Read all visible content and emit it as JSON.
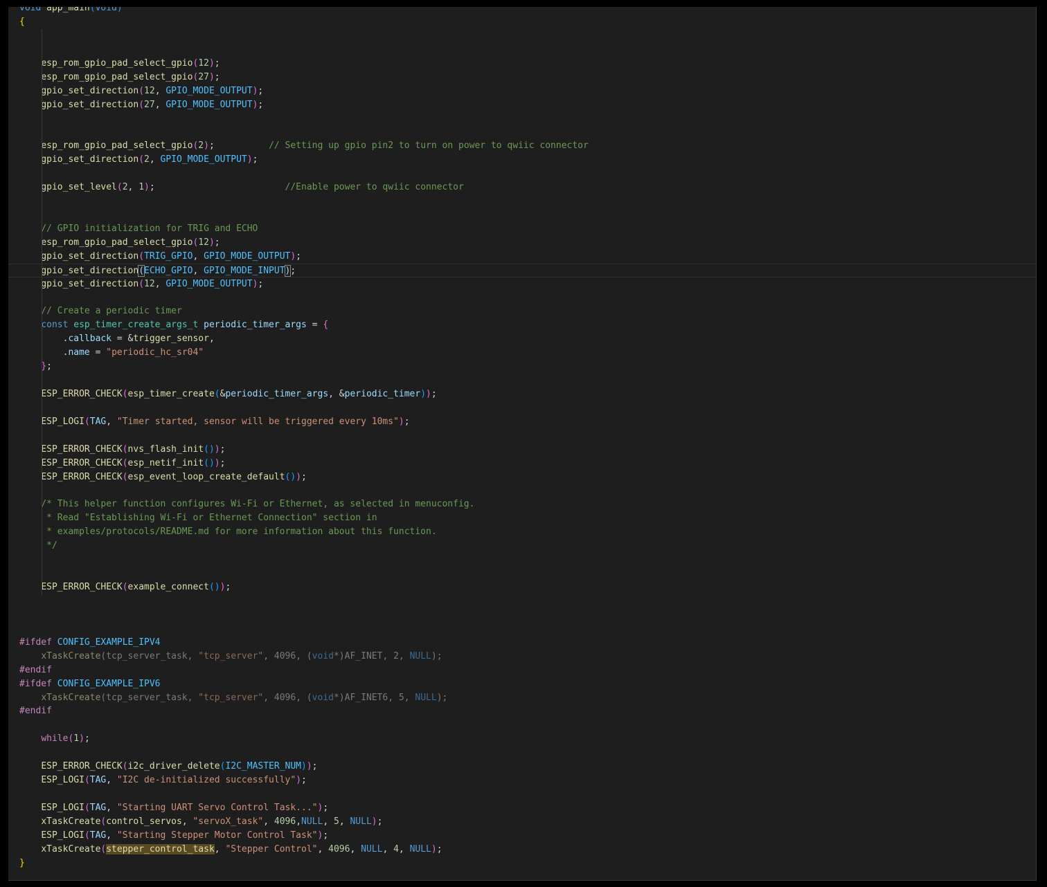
{
  "editor": {
    "language": "c",
    "theme": "dark",
    "colors": {
      "background": "#1e1e1e",
      "default": "#d4d4d4",
      "keyword": "#569cd6",
      "function": "#dcdcaa",
      "string": "#ce9178",
      "number": "#b5cea8",
      "comment": "#6a9955",
      "constant": "#4fc1ff",
      "macro": "#c586c0"
    },
    "current_line": 19,
    "lines": [
      [
        [
          "void",
          "kw"
        ],
        [
          " app_main",
          "fn"
        ],
        [
          "(",
          "bracket"
        ],
        [
          "void",
          "kw"
        ],
        [
          ")",
          "bracket"
        ]
      ],
      [
        [
          "{",
          "brace"
        ]
      ],
      [],
      [],
      [
        [
          "    "
        ],
        [
          "esp_rom_gpio_pad_select_gpio",
          "fn"
        ],
        [
          "(",
          "paren"
        ],
        [
          "12",
          "num"
        ],
        [
          ")",
          "paren"
        ],
        [
          ";"
        ]
      ],
      [
        [
          "    "
        ],
        [
          "esp_rom_gpio_pad_select_gpio",
          "fn"
        ],
        [
          "(",
          "paren"
        ],
        [
          "27",
          "num"
        ],
        [
          ")",
          "paren"
        ],
        [
          ";"
        ]
      ],
      [
        [
          "    "
        ],
        [
          "gpio_set_direction",
          "fn"
        ],
        [
          "(",
          "paren"
        ],
        [
          "12",
          "num"
        ],
        [
          ", "
        ],
        [
          "GPIO_MODE_OUTPUT",
          "const"
        ],
        [
          ")",
          "paren"
        ],
        [
          ";"
        ]
      ],
      [
        [
          "    "
        ],
        [
          "gpio_set_direction",
          "fn"
        ],
        [
          "(",
          "paren"
        ],
        [
          "27",
          "num"
        ],
        [
          ", "
        ],
        [
          "GPIO_MODE_OUTPUT",
          "const"
        ],
        [
          ")",
          "paren"
        ],
        [
          ";"
        ]
      ],
      [],
      [],
      [
        [
          "    "
        ],
        [
          "esp_rom_gpio_pad_select_gpio",
          "fn"
        ],
        [
          "(",
          "paren"
        ],
        [
          "2",
          "num"
        ],
        [
          ")",
          "paren"
        ],
        [
          ";"
        ],
        [
          "          "
        ],
        [
          "// Setting up gpio pin2 to turn on power to qwiic connector",
          "cmt"
        ]
      ],
      [
        [
          "    "
        ],
        [
          "gpio_set_direction",
          "fn"
        ],
        [
          "(",
          "paren"
        ],
        [
          "2",
          "num"
        ],
        [
          ", "
        ],
        [
          "GPIO_MODE_OUTPUT",
          "const"
        ],
        [
          ")",
          "paren"
        ],
        [
          ";"
        ]
      ],
      [],
      [
        [
          "    "
        ],
        [
          "gpio_set_level",
          "fn"
        ],
        [
          "(",
          "paren"
        ],
        [
          "2",
          "num"
        ],
        [
          ", "
        ],
        [
          "1",
          "num"
        ],
        [
          ")",
          "paren"
        ],
        [
          ";"
        ],
        [
          "                        "
        ],
        [
          "//Enable power to qwiic connector",
          "cmt"
        ]
      ],
      [],
      [],
      [
        [
          "    "
        ],
        [
          "// GPIO initialization for TRIG and ECHO",
          "cmt"
        ]
      ],
      [
        [
          "    "
        ],
        [
          "esp_rom_gpio_pad_select_gpio",
          "fn"
        ],
        [
          "(",
          "paren"
        ],
        [
          "12",
          "num"
        ],
        [
          ")",
          "paren"
        ],
        [
          ";"
        ]
      ],
      [
        [
          "    "
        ],
        [
          "gpio_set_direction",
          "fn"
        ],
        [
          "(",
          "paren"
        ],
        [
          "TRIG_GPIO",
          "const"
        ],
        [
          ", "
        ],
        [
          "GPIO_MODE_OUTPUT",
          "const"
        ],
        [
          ")",
          "paren"
        ],
        [
          ";"
        ]
      ],
      [
        [
          "    "
        ],
        [
          "gpio_set_direction",
          "fn"
        ],
        [
          "(",
          "match"
        ],
        [
          "ECHO_GPIO",
          "const"
        ],
        [
          ", "
        ],
        [
          "GPIO_MODE_INPUT",
          "const"
        ],
        [
          ")",
          "match"
        ],
        [
          ";"
        ]
      ],
      [
        [
          "    "
        ],
        [
          "gpio_set_direction",
          "fn"
        ],
        [
          "(",
          "paren"
        ],
        [
          "12",
          "num"
        ],
        [
          ", "
        ],
        [
          "GPIO_MODE_OUTPUT",
          "const"
        ],
        [
          ")",
          "paren"
        ],
        [
          ";"
        ]
      ],
      [],
      [
        [
          "    "
        ],
        [
          "// Create a periodic timer",
          "cmt"
        ]
      ],
      [
        [
          "    "
        ],
        [
          "const",
          "kw"
        ],
        [
          " "
        ],
        [
          "esp_timer_create_args_t",
          "type"
        ],
        [
          " "
        ],
        [
          "periodic_timer_args",
          "var"
        ],
        [
          " = "
        ],
        [
          "{",
          "paren"
        ]
      ],
      [
        [
          "        ."
        ],
        [
          "callback",
          "var"
        ],
        [
          " = &"
        ],
        [
          "trigger_sensor",
          "fn"
        ],
        [
          ","
        ]
      ],
      [
        [
          "        ."
        ],
        [
          "name",
          "var"
        ],
        [
          " = "
        ],
        [
          "\"periodic_hc_sr04\"",
          "str"
        ]
      ],
      [
        [
          "    "
        ],
        [
          "}",
          "paren"
        ],
        [
          ";"
        ]
      ],
      [],
      [
        [
          "    "
        ],
        [
          "ESP_ERROR_CHECK",
          "fn"
        ],
        [
          "(",
          "paren"
        ],
        [
          "esp_timer_create",
          "fn"
        ],
        [
          "(",
          "bracket"
        ],
        [
          "&"
        ],
        [
          "periodic_timer_args",
          "var"
        ],
        [
          ", &"
        ],
        [
          "periodic_timer",
          "var"
        ],
        [
          ")",
          "bracket"
        ],
        [
          ")",
          "paren"
        ],
        [
          ";"
        ]
      ],
      [],
      [
        [
          "    "
        ],
        [
          "ESP_LOGI",
          "fn"
        ],
        [
          "(",
          "paren"
        ],
        [
          "TAG",
          "var"
        ],
        [
          ", "
        ],
        [
          "\"Timer started, sensor will be triggered every 10ms\"",
          "str"
        ],
        [
          ")",
          "paren"
        ],
        [
          ";"
        ]
      ],
      [],
      [
        [
          "    "
        ],
        [
          "ESP_ERROR_CHECK",
          "fn"
        ],
        [
          "(",
          "paren"
        ],
        [
          "nvs_flash_init",
          "fn"
        ],
        [
          "()",
          "bracket"
        ],
        [
          ")",
          "paren"
        ],
        [
          ";"
        ]
      ],
      [
        [
          "    "
        ],
        [
          "ESP_ERROR_CHECK",
          "fn"
        ],
        [
          "(",
          "paren"
        ],
        [
          "esp_netif_init",
          "fn"
        ],
        [
          "()",
          "bracket"
        ],
        [
          ")",
          "paren"
        ],
        [
          ";"
        ]
      ],
      [
        [
          "    "
        ],
        [
          "ESP_ERROR_CHECK",
          "fn"
        ],
        [
          "(",
          "paren"
        ],
        [
          "esp_event_loop_create_default",
          "fn"
        ],
        [
          "()",
          "bracket"
        ],
        [
          ")",
          "paren"
        ],
        [
          ";"
        ]
      ],
      [],
      [
        [
          "    "
        ],
        [
          "/* This helper function configures Wi-Fi or Ethernet, as selected in menuconfig.",
          "cmt"
        ]
      ],
      [
        [
          "     "
        ],
        [
          "* Read \"Establishing Wi-Fi or Ethernet Connection\" section in",
          "cmt"
        ]
      ],
      [
        [
          "     "
        ],
        [
          "* examples/protocols/README.md for more information about this function.",
          "cmt"
        ]
      ],
      [
        [
          "     "
        ],
        [
          "*/",
          "cmt"
        ]
      ],
      [],
      [],
      [
        [
          "    "
        ],
        [
          "ESP_ERROR_CHECK",
          "fn"
        ],
        [
          "(",
          "paren"
        ],
        [
          "example_connect",
          "fn"
        ],
        [
          "()",
          "bracket"
        ],
        [
          ")",
          "paren"
        ],
        [
          ";"
        ]
      ],
      [],
      [],
      [],
      [
        [
          "#ifdef",
          "macro"
        ],
        [
          " "
        ],
        [
          "CONFIG_EXAMPLE_IPV4",
          "const"
        ]
      ],
      [
        [
          "    "
        ],
        [
          "xTaskCreate",
          "dimfn"
        ],
        [
          "(",
          "dim"
        ],
        [
          "tcp_server_task",
          "dim"
        ],
        [
          ", ",
          "dim"
        ],
        [
          "\"tcp_server\"",
          "dimstr"
        ],
        [
          ", ",
          "dim"
        ],
        [
          "4096",
          "dim"
        ],
        [
          ", ",
          "dim"
        ],
        [
          "(",
          "dim"
        ],
        [
          "void",
          "dimkw"
        ],
        [
          "*)",
          "dim"
        ],
        [
          "AF_INET",
          "dim"
        ],
        [
          ", ",
          "dim"
        ],
        [
          "2",
          "dim"
        ],
        [
          ", ",
          "dim"
        ],
        [
          "NULL",
          "dimkw"
        ],
        [
          ");",
          "dim"
        ]
      ],
      [
        [
          "#endif",
          "macro"
        ]
      ],
      [
        [
          "#ifdef",
          "macro"
        ],
        [
          " "
        ],
        [
          "CONFIG_EXAMPLE_IPV6",
          "const"
        ]
      ],
      [
        [
          "    "
        ],
        [
          "xTaskCreate",
          "dimfn"
        ],
        [
          "(",
          "dim"
        ],
        [
          "tcp_server_task",
          "dim"
        ],
        [
          ", ",
          "dim"
        ],
        [
          "\"tcp_server\"",
          "dimstr"
        ],
        [
          ", ",
          "dim"
        ],
        [
          "4096",
          "dim"
        ],
        [
          ", ",
          "dim"
        ],
        [
          "(",
          "dim"
        ],
        [
          "void",
          "dimkw"
        ],
        [
          "*)",
          "dim"
        ],
        [
          "AF_INET6",
          "dim"
        ],
        [
          ", ",
          "dim"
        ],
        [
          "5",
          "dim"
        ],
        [
          ", ",
          "dim"
        ],
        [
          "NULL",
          "dimkw"
        ],
        [
          ");",
          "dim"
        ]
      ],
      [
        [
          "#endif",
          "macro"
        ]
      ],
      [],
      [
        [
          "    "
        ],
        [
          "while",
          "macro"
        ],
        [
          "(",
          "paren"
        ],
        [
          "1",
          "num"
        ],
        [
          ")",
          "paren"
        ],
        [
          ";"
        ]
      ],
      [],
      [
        [
          "    "
        ],
        [
          "ESP_ERROR_CHECK",
          "fn"
        ],
        [
          "(",
          "paren"
        ],
        [
          "i2c_driver_delete",
          "fn"
        ],
        [
          "(",
          "bracket"
        ],
        [
          "I2C_MASTER_NUM",
          "const"
        ],
        [
          ")",
          "bracket"
        ],
        [
          ")",
          "paren"
        ],
        [
          ";"
        ]
      ],
      [
        [
          "    "
        ],
        [
          "ESP_LOGI",
          "fn"
        ],
        [
          "(",
          "paren"
        ],
        [
          "TAG",
          "var"
        ],
        [
          ", "
        ],
        [
          "\"I2C de-initialized successfully\"",
          "str"
        ],
        [
          ")",
          "paren"
        ],
        [
          ";"
        ]
      ],
      [],
      [
        [
          "    "
        ],
        [
          "ESP_LOGI",
          "fn"
        ],
        [
          "(",
          "paren"
        ],
        [
          "TAG",
          "var"
        ],
        [
          ", "
        ],
        [
          "\"Starting UART Servo Control Task...\"",
          "str"
        ],
        [
          ")",
          "paren"
        ],
        [
          ";"
        ]
      ],
      [
        [
          "    "
        ],
        [
          "xTaskCreate",
          "fn"
        ],
        [
          "(",
          "paren"
        ],
        [
          "control_servos",
          "fn"
        ],
        [
          ", "
        ],
        [
          "\"servoX_task\"",
          "str"
        ],
        [
          ", "
        ],
        [
          "4096",
          "num"
        ],
        [
          ","
        ],
        [
          "NULL",
          "kw"
        ],
        [
          ", "
        ],
        [
          "5",
          "num"
        ],
        [
          ", "
        ],
        [
          "NULL",
          "kw"
        ],
        [
          ")",
          "paren"
        ],
        [
          ";"
        ]
      ],
      [
        [
          "    "
        ],
        [
          "ESP_LOGI",
          "fn"
        ],
        [
          "(",
          "paren"
        ],
        [
          "TAG",
          "var"
        ],
        [
          ", "
        ],
        [
          "\"Starting Stepper Motor Control Task\"",
          "str"
        ],
        [
          ")",
          "paren"
        ],
        [
          ";"
        ]
      ],
      [
        [
          "    "
        ],
        [
          "xTaskCreate",
          "fn"
        ],
        [
          "(",
          "paren"
        ],
        [
          "stepper_control_task",
          "sel"
        ],
        [
          ", "
        ],
        [
          "\"Stepper Control\"",
          "str"
        ],
        [
          ", "
        ],
        [
          "4096",
          "num"
        ],
        [
          ", "
        ],
        [
          "NULL",
          "kw"
        ],
        [
          ", "
        ],
        [
          "4",
          "num"
        ],
        [
          ", "
        ],
        [
          "NULL",
          "kw"
        ],
        [
          ")",
          "paren"
        ],
        [
          ";"
        ]
      ],
      [
        [
          "}",
          "brace"
        ]
      ]
    ]
  }
}
